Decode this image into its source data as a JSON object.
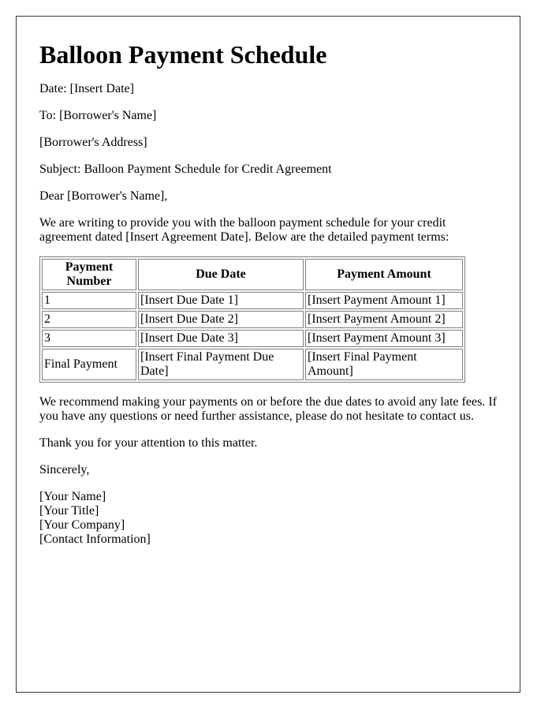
{
  "title": "Balloon Payment Schedule",
  "header": {
    "date_line": "Date: [Insert Date]",
    "to_line": "To: [Borrower's Name]",
    "address_line": "[Borrower's Address]",
    "subject_line": "Subject: Balloon Payment Schedule for Credit Agreement",
    "salutation": "Dear [Borrower's Name],"
  },
  "intro_paragraph": "We are writing to provide you with the balloon payment schedule for your credit agreement dated [Insert Agreement Date]. Below are the detailed payment terms:",
  "table": {
    "headers": [
      "Payment Number",
      "Due Date",
      "Payment Amount"
    ],
    "rows": [
      [
        "1",
        "[Insert Due Date 1]",
        "[Insert Payment Amount 1]"
      ],
      [
        "2",
        "[Insert Due Date 2]",
        "[Insert Payment Amount 2]"
      ],
      [
        "3",
        "[Insert Due Date 3]",
        "[Insert Payment Amount 3]"
      ],
      [
        "Final Payment",
        "[Insert Final Payment Due Date]",
        "[Insert Final Payment Amount]"
      ]
    ]
  },
  "closing_paragraph": "We recommend making your payments on or before the due dates to avoid any late fees. If you have any questions or need further assistance, please do not hesitate to contact us.",
  "thanks_line": "Thank you for your attention to this matter.",
  "valediction": "Sincerely,",
  "signature": {
    "name": "[Your Name]",
    "title": "[Your Title]",
    "company": "[Your Company]",
    "contact": "[Contact Information]"
  }
}
